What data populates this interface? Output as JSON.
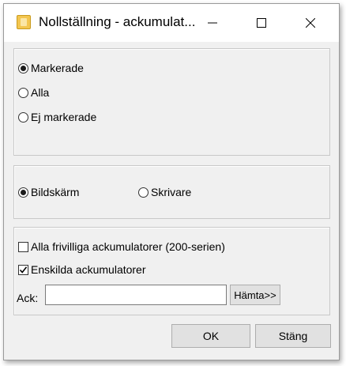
{
  "window": {
    "title": "Nollställning - ackumulat..."
  },
  "selection_group": {
    "options": [
      {
        "label": "Markerade",
        "checked": true
      },
      {
        "label": "Alla",
        "checked": false
      },
      {
        "label": "Ej markerade",
        "checked": false
      }
    ]
  },
  "output_group": {
    "options": [
      {
        "label": "Bildskärm",
        "checked": true
      },
      {
        "label": "Skrivare",
        "checked": false
      }
    ]
  },
  "accumulator_group": {
    "all_voluntary_label": "Alla frivilliga ackumulatorer (200-serien)",
    "all_voluntary_checked": false,
    "individual_label": "Enskilda ackumulatorer",
    "individual_checked": true,
    "ack_label": "Ack:",
    "ack_value": "",
    "fetch_button_label": "Hämta>>"
  },
  "footer": {
    "ok_label": "OK",
    "close_label": "Stäng"
  }
}
